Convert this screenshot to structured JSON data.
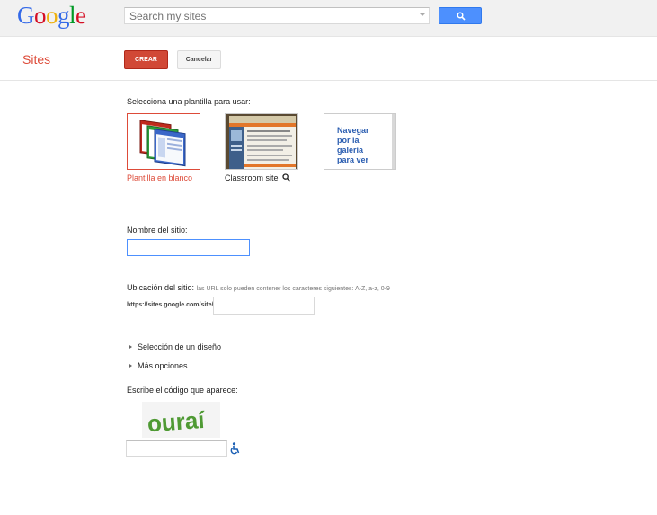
{
  "header": {
    "logo_letters": [
      {
        "ch": "G",
        "color": "#3369e8"
      },
      {
        "ch": "o",
        "color": "#d50f25"
      },
      {
        "ch": "o",
        "color": "#eeb211"
      },
      {
        "ch": "g",
        "color": "#3369e8"
      },
      {
        "ch": "l",
        "color": "#009925"
      },
      {
        "ch": "e",
        "color": "#d50f25"
      }
    ],
    "search_placeholder": "Search my sites",
    "search_icon": "search-icon"
  },
  "toolbar": {
    "app_title": "Sites",
    "create_label": "CREAR",
    "cancel_label": "Cancelar",
    "accent": "#d14836"
  },
  "form": {
    "template_prompt": "Selecciona una plantilla para usar:",
    "templates": [
      {
        "caption": "Plantilla en blanco",
        "selected": true
      },
      {
        "caption": "Classroom site",
        "selected": false
      }
    ],
    "browse_gallery": "Navegar por la galería para ver",
    "site_name_label": "Nombre del sitio:",
    "site_name_value": "",
    "location_label": "Ubicación del sitio:",
    "location_note": "las URL solo pueden contener los caracteres siguientes: A-Z, a-z, 0-9",
    "url_prefix": "https://sites.google.com/site/",
    "url_value": "",
    "theme_toggle": "Selección de un diseño",
    "more_options": "Más opciones",
    "captcha_label": "Escribe el código que aparece:",
    "captcha_text": "ouraí",
    "captcha_value": ""
  }
}
